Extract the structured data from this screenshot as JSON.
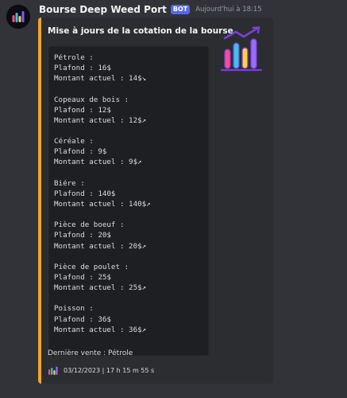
{
  "message": {
    "author": "Bourse Deep Weed Port",
    "bot_tag": "BOT",
    "timestamp": "Aujourd'hui à 18:15",
    "avatar_icon": "bar-chart-icon"
  },
  "embed": {
    "accent_color": "#f0a52c",
    "title": "Mise à jours de la cotation de la bourse",
    "thumbnail_icon": "rising-bar-chart-icon",
    "code_lines": [
      "Pétrole :",
      "Plafond : 16$",
      "Montant actuel : 14$↘",
      "",
      "Copeaux de bois :",
      "Plafond : 12$",
      "Montant actuel : 12$↗",
      "",
      "Céréale :",
      "Plafond : 9$",
      "Montant actuel : 9$↗",
      "",
      "Biére :",
      "Plafond : 140$",
      "Montant actuel : 140$↗",
      "",
      "Pièce de boeuf :",
      "Plafond : 20$",
      "Montant actuel : 20$↗",
      "",
      "Pièce de poulet :",
      "Plafond : 25$",
      "Montant actuel : 25$↗",
      "",
      "Poisson :",
      "Plafond : 36$",
      "Montant actuel : 36$↗"
    ],
    "description": "Dernière vente : Pétrole",
    "footer": {
      "icon": "bar-chart-icon",
      "text": "03/12/2023 | 17 h 15 m 55 s"
    }
  }
}
